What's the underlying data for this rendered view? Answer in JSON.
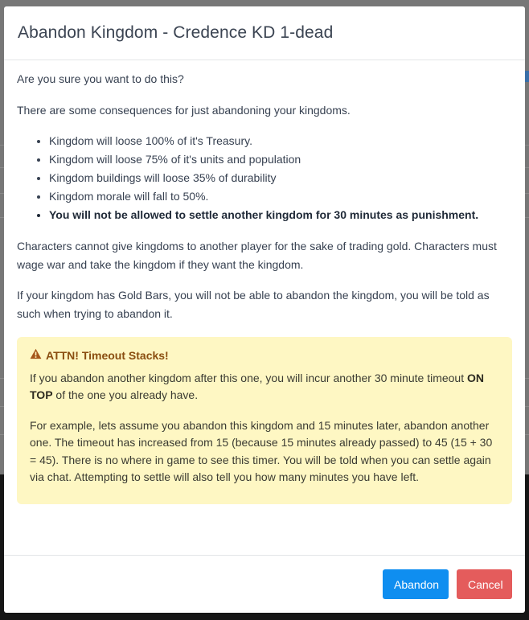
{
  "modal": {
    "title": "Abandon Kingdom - Credence KD 1-dead",
    "intro": "Are you sure you want to do this?",
    "consequences_lead": "There are some consequences for just abandoning your kingdoms.",
    "consequences": [
      "Kingdom will loose 100% of it's Treasury.",
      "Kingdom will loose 75% of it's units and population",
      "Kingdom buildings will loose 35% of durability",
      "Kingdom morale will fall to 50%.",
      "You will not be allowed to settle another kingdom for 30 minutes as punishment."
    ],
    "trading_note": "Characters cannot give kingdoms to another player for the sake of trading gold. Characters must wage war and take the kingdom if they want the kingdom.",
    "gold_bars_note": "If your kingdom has Gold Bars, you will not be able to abandon the kingdom, you will be told as such when trying to abandon it.",
    "alert": {
      "icon": "warning-icon",
      "title": "ATTN! Timeout Stacks!",
      "p1_before": "If you abandon another kingdom after this one, you will incur another 30 minute timeout ",
      "p1_bold": "ON TOP",
      "p1_after": " of the one you already have.",
      "p2": "For example, lets assume you abandon this kingdom and 15 minutes later, abandon another one. The timeout has increased from 15 (because 15 minutes already passed) to 45 (15 + 30 = 45). There is no where in game to see this timer. You will be told when you can settle again via chat. Attempting to settle will also tell you how many minutes you have left."
    },
    "footer": {
      "abandon_label": "Abandon",
      "cancel_label": "Cancel"
    }
  },
  "colors": {
    "primary": "#0f8ef0",
    "danger": "#e45c5c",
    "alert_bg": "#fef7c3",
    "alert_title": "#8a4e10"
  }
}
